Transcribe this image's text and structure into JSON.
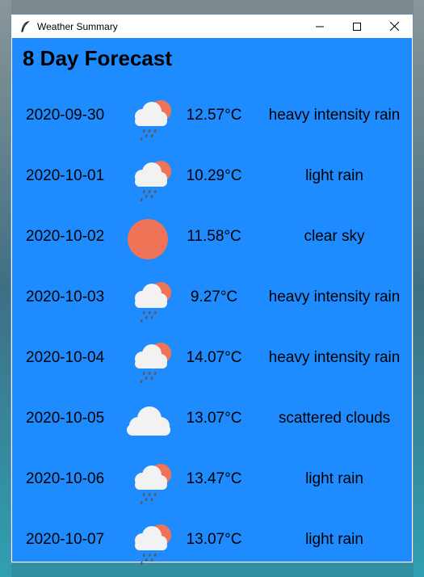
{
  "window": {
    "title": "Weather Summary",
    "controls": {
      "minimize_icon": "minimize-icon",
      "maximize_icon": "maximize-icon",
      "close_icon": "close-icon"
    }
  },
  "colors": {
    "background": "#1e8cff",
    "sun": "#ef7356",
    "cloud": "#f2f2f2",
    "rain": "#5a5a5a"
  },
  "forecast": {
    "heading": "8 Day Forecast",
    "days": [
      {
        "date": "2020-09-30",
        "icon": "rain-cloud-sun-icon",
        "temp": "12.57°C",
        "description": "heavy intensity rain"
      },
      {
        "date": "2020-10-01",
        "icon": "rain-cloud-sun-icon",
        "temp": "10.29°C",
        "description": "light rain"
      },
      {
        "date": "2020-10-02",
        "icon": "sun-icon",
        "temp": "11.58°C",
        "description": "clear sky"
      },
      {
        "date": "2020-10-03",
        "icon": "rain-cloud-sun-icon",
        "temp": "9.27°C",
        "description": "heavy intensity rain"
      },
      {
        "date": "2020-10-04",
        "icon": "rain-cloud-sun-icon",
        "temp": "14.07°C",
        "description": "heavy intensity rain"
      },
      {
        "date": "2020-10-05",
        "icon": "cloud-icon",
        "temp": "13.07°C",
        "description": "scattered clouds"
      },
      {
        "date": "2020-10-06",
        "icon": "rain-cloud-sun-icon",
        "temp": "13.47°C",
        "description": "light rain"
      },
      {
        "date": "2020-10-07",
        "icon": "rain-cloud-sun-icon",
        "temp": "13.07°C",
        "description": "light rain"
      }
    ]
  }
}
